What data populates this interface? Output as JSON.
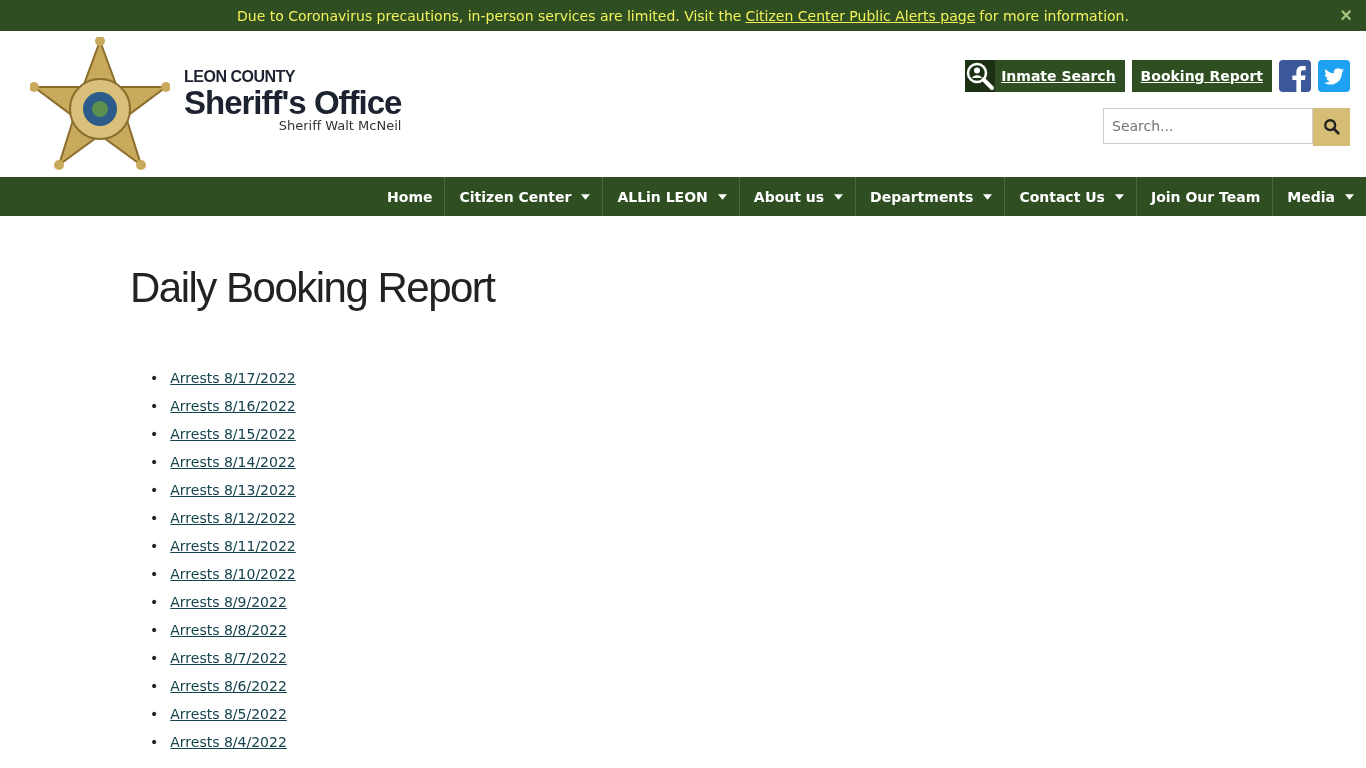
{
  "alert": {
    "before": "Due to Coronavirus precautions, in-person services are limited. Visit the",
    "link": "Citizen Center Public Alerts page",
    "after": "for more information.",
    "close": "×"
  },
  "brand": {
    "county": "LEON COUNTY",
    "office": "Sheriff's Office",
    "sheriff": "Sheriff Walt McNeil"
  },
  "quick_links": [
    {
      "label": "Inmate Search",
      "kind": "icon"
    },
    {
      "label": "Booking Report",
      "kind": "plain"
    }
  ],
  "search": {
    "placeholder": "Search..."
  },
  "nav": [
    {
      "label": "Home",
      "dropdown": false
    },
    {
      "label": "Citizen Center",
      "dropdown": true
    },
    {
      "label": "ALLin LEON",
      "dropdown": true
    },
    {
      "label": "About us",
      "dropdown": true
    },
    {
      "label": "Departments",
      "dropdown": true
    },
    {
      "label": "Contact Us",
      "dropdown": true
    },
    {
      "label": "Join Our Team",
      "dropdown": false
    },
    {
      "label": "Media",
      "dropdown": true
    }
  ],
  "page_title": "Daily Booking Report",
  "reports": [
    {
      "bullet": "•",
      "label": "Arrests 8/17/2022"
    },
    {
      "bullet": "•",
      "label": "Arrests 8/16/2022"
    },
    {
      "bullet": "•",
      "label": "Arrests 8/15/2022"
    },
    {
      "bullet": "•",
      "label": "Arrests 8/14/2022"
    },
    {
      "bullet": "•",
      "label": "Arrests 8/13/2022"
    },
    {
      "bullet": "•",
      "label": "Arrests 8/12/2022"
    },
    {
      "bullet": "•",
      "label": "Arrests 8/11/2022"
    },
    {
      "bullet": "•",
      "label": "Arrests 8/10/2022"
    },
    {
      "bullet": "•",
      "label": "Arrests 8/9/2022"
    },
    {
      "bullet": "•",
      "label": "Arrests 8/8/2022"
    },
    {
      "bullet": "•",
      "label": "Arrests 8/7/2022"
    },
    {
      "bullet": "•",
      "label": "Arrests 8/6/2022"
    },
    {
      "bullet": "•",
      "label": "Arrests 8/5/2022"
    },
    {
      "bullet": "•",
      "label": "Arrests 8/4/2022"
    }
  ]
}
